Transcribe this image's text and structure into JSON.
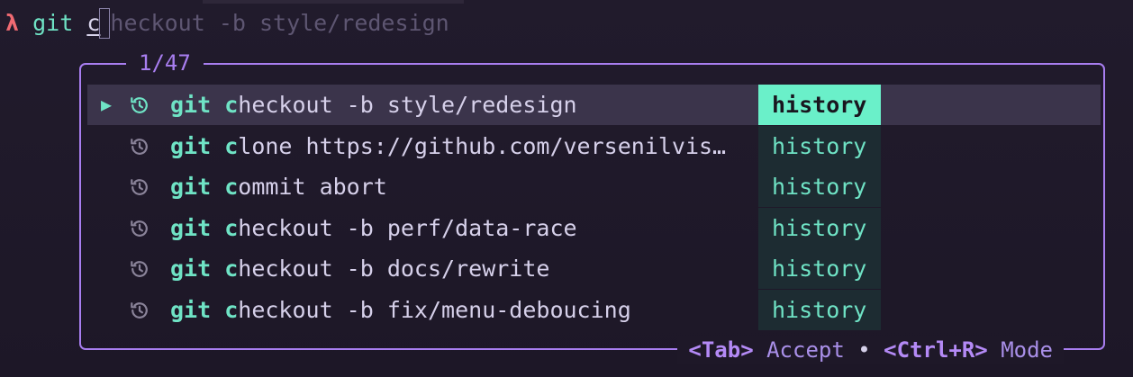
{
  "prompt": {
    "symbol": "λ",
    "command": "git",
    "typed": "c",
    "suggestion": "heckout -b style/redesign"
  },
  "panel": {
    "counter": "1/47",
    "footer": {
      "accept_key": "<Tab>",
      "accept_label": "Accept",
      "separator": "•",
      "mode_key": "<Ctrl+R>",
      "mode_label": "Mode"
    }
  },
  "items": [
    {
      "prefix": "git c",
      "rest": "heckout -b style/redesign",
      "tag": "history",
      "selected": true
    },
    {
      "prefix": "git c",
      "rest": "lone https://github.com/versenilvis…",
      "tag": "history",
      "selected": false
    },
    {
      "prefix": "git c",
      "rest": "ommit abort",
      "tag": "history",
      "selected": false
    },
    {
      "prefix": "git c",
      "rest": "heckout -b perf/data-race",
      "tag": "history",
      "selected": false
    },
    {
      "prefix": "git c",
      "rest": "heckout -b docs/rewrite",
      "tag": "history",
      "selected": false
    },
    {
      "prefix": "git c",
      "rest": "heckout -b fix/menu-deboucing",
      "tag": "history",
      "selected": false
    }
  ],
  "colors": {
    "accent": "#a87ef0",
    "highlight": "#6fe3c5",
    "prompt_symbol": "#f06a72"
  },
  "icons": {
    "selection": "play-triangle",
    "item": "history-clock-icon"
  }
}
